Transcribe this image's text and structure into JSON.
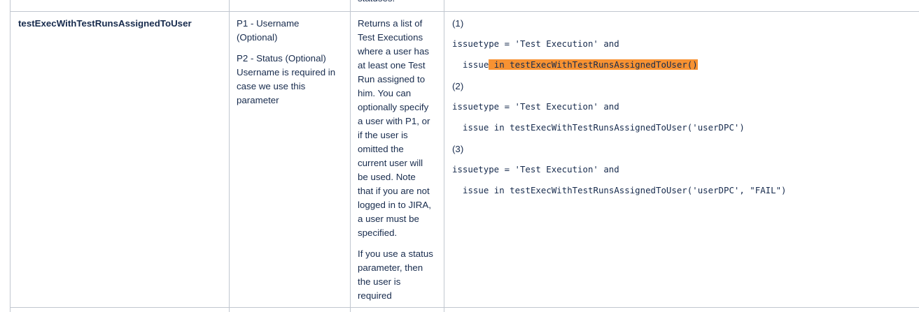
{
  "top_fragment": "statuses.",
  "row": {
    "function_name": "testExecWithTestRunsAssignedToUser",
    "params": {
      "p1_line1": "P1 - Username",
      "p1_line2": "(Optional)",
      "p2_line1": "P2 - Status (Optional)",
      "p2_line2": "Username is required in",
      "p2_line3": "case we use this",
      "p2_line4": "parameter"
    },
    "description": {
      "lines": [
        "Returns a list of",
        "Test Executions",
        "where a user has",
        "at least one Test",
        "Run assigned to",
        "him. You can",
        "optionally specify",
        "a user with P1, or",
        "if the user is",
        "omitted the",
        "current user will",
        "be used. Note",
        "that if you are not",
        "logged in to JIRA,",
        "a user must be",
        "specified."
      ],
      "note_lines": [
        "If you use a status",
        "parameter, then",
        "the user is",
        "required"
      ]
    },
    "examples": {
      "ex1_label": "(1)",
      "ex1_line1": "issuetype = 'Test Execution' and",
      "ex1_line2_plain": "issue",
      "ex1_line2_highlight": " in testExecWithTestRunsAssignedToUser()",
      "ex2_label": "(2)",
      "ex2_line1": "issuetype = 'Test Execution' and",
      "ex2_line2": "issue in testExecWithTestRunsAssignedToUser('userDPC')",
      "ex3_label": "(3)",
      "ex3_line1": "issuetype = 'Test Execution' and",
      "ex3_line2": "issue in testExecWithTestRunsAssignedToUser('userDPC', \"FAIL\")"
    }
  },
  "colors": {
    "border": "#c1c7d0",
    "text": "#172b4d",
    "highlight": "#f79232"
  }
}
